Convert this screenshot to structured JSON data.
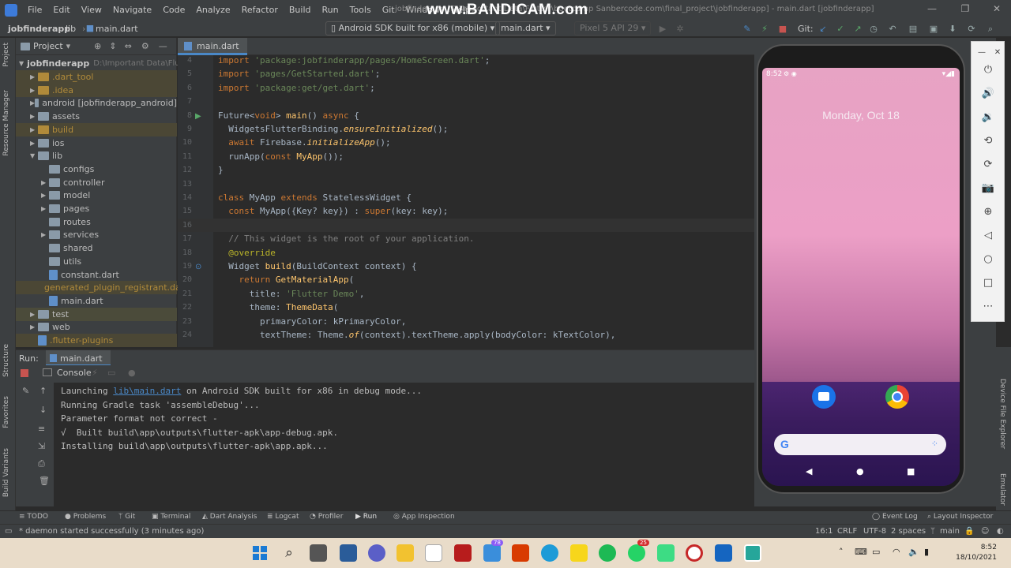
{
  "menubar": {
    "items": [
      "File",
      "Edit",
      "View",
      "Navigate",
      "Code",
      "Analyze",
      "Refactor",
      "Build",
      "Run",
      "Tools",
      "Git",
      "Window",
      "Help"
    ],
    "title": "jobfinderapp [D:\\Important Data\\Flutter\\bootcamp Sanbercode.com\\final_project\\jobfinderapp] - main.dart [jobfinderapp]",
    "watermark": "www.BANDICAM.com"
  },
  "toolbar": {
    "breadcrumb": [
      "jobfinderapp",
      "lib",
      "main.dart"
    ],
    "device_combo": "Android SDK built for x86 (mobile)",
    "config_combo": "main.dart",
    "avd_combo": "Pixel 5 API 29",
    "git_label": "Git:"
  },
  "project_panel": {
    "title": "Project",
    "root": {
      "name": "jobfinderapp",
      "path": "D:\\Important Data\\Flutt"
    },
    "items": [
      {
        "label": ".dart_tool",
        "kind": "folder",
        "excluded": true,
        "indent": 1,
        "expandable": true
      },
      {
        "label": ".idea",
        "kind": "folder",
        "excluded": true,
        "indent": 1,
        "expandable": true
      },
      {
        "label": "android [jobfinderapp_android]",
        "kind": "folder",
        "excluded": false,
        "indent": 1,
        "expandable": true
      },
      {
        "label": "assets",
        "kind": "folder",
        "excluded": false,
        "indent": 1,
        "expandable": true
      },
      {
        "label": "build",
        "kind": "folder",
        "excluded": true,
        "indent": 1,
        "expandable": true
      },
      {
        "label": "ios",
        "kind": "folder",
        "excluded": false,
        "indent": 1,
        "expandable": true
      },
      {
        "label": "lib",
        "kind": "folder",
        "excluded": false,
        "indent": 1,
        "expandable": true,
        "expanded": true
      },
      {
        "label": "configs",
        "kind": "folder",
        "excluded": false,
        "indent": 2,
        "expandable": false
      },
      {
        "label": "controller",
        "kind": "folder",
        "excluded": false,
        "indent": 2,
        "expandable": true
      },
      {
        "label": "model",
        "kind": "folder",
        "excluded": false,
        "indent": 2,
        "expandable": true
      },
      {
        "label": "pages",
        "kind": "folder",
        "excluded": false,
        "indent": 2,
        "expandable": true
      },
      {
        "label": "routes",
        "kind": "folder",
        "excluded": false,
        "indent": 2,
        "expandable": false
      },
      {
        "label": "services",
        "kind": "folder",
        "excluded": false,
        "indent": 2,
        "expandable": true
      },
      {
        "label": "shared",
        "kind": "folder",
        "excluded": false,
        "indent": 2,
        "expandable": false
      },
      {
        "label": "utils",
        "kind": "folder",
        "excluded": false,
        "indent": 2,
        "expandable": false
      },
      {
        "label": "constant.dart",
        "kind": "file",
        "excluded": false,
        "indent": 2,
        "expandable": false
      },
      {
        "label": "generated_plugin_registrant.dart",
        "kind": "file",
        "excluded": true,
        "indent": 2,
        "expandable": false
      },
      {
        "label": "main.dart",
        "kind": "file",
        "excluded": false,
        "indent": 2,
        "expandable": false
      },
      {
        "label": "test",
        "kind": "folder",
        "excluded": false,
        "indent": 1,
        "expandable": true,
        "selected": true
      },
      {
        "label": "web",
        "kind": "folder",
        "excluded": false,
        "indent": 1,
        "expandable": true
      },
      {
        "label": ".flutter-plugins",
        "kind": "file",
        "excluded": true,
        "indent": 1,
        "expandable": false
      }
    ]
  },
  "editor": {
    "tab": "main.dart",
    "lines": [
      {
        "n": "4",
        "html": "<span class='kw'>import</span> <span class='str'>'package:jobfinderapp/pages/HomeScreen.dart'</span>;"
      },
      {
        "n": "5",
        "html": "<span class='kw'>import</span> <span class='str'>'pages/GetStarted.dart'</span>;"
      },
      {
        "n": "6",
        "html": "<span class='kw'>import</span> <span class='str'>'package:get/get.dart'</span>;"
      },
      {
        "n": "7",
        "html": ""
      },
      {
        "n": "8",
        "html": "Future&lt;<span class='kw'>void</span>&gt; <span class='fn'>main</span>() <span class='kw'>async</span> {"
      },
      {
        "n": "9",
        "html": "  WidgetsFlutterBinding.<span class='fn it'>ensureInitialized</span>();"
      },
      {
        "n": "10",
        "html": "  <span class='kw'>await</span> Firebase.<span class='fn it'>initializeApp</span>();"
      },
      {
        "n": "11",
        "html": "  runApp(<span class='kw'>const</span> <span class='fn'>MyApp</span>());"
      },
      {
        "n": "12",
        "html": "}"
      },
      {
        "n": "13",
        "html": ""
      },
      {
        "n": "14",
        "html": "<span class='kw'>class</span> MyApp <span class='kw'>extends</span> StatelessWidget {"
      },
      {
        "n": "15",
        "html": "  <span class='kw'>const</span> MyApp({Key? key}) : <span class='kw'>super</span>(key: key);"
      },
      {
        "n": "16",
        "html": ""
      },
      {
        "n": "17",
        "html": "  <span class='cm'>// This widget is the root of your application.</span>"
      },
      {
        "n": "18",
        "html": "  <span class='ann'>@override</span>"
      },
      {
        "n": "19",
        "html": "  Widget <span class='fn'>build</span>(BuildContext context) {"
      },
      {
        "n": "20",
        "html": "    <span class='kw'>return</span> <span class='fn'>GetMaterialApp</span>("
      },
      {
        "n": "21",
        "html": "      title: <span class='str'>'Flutter Demo'</span>,"
      },
      {
        "n": "22",
        "html": "      theme: <span class='fn'>ThemeData</span>("
      },
      {
        "n": "23",
        "html": "        primaryColor: kPrimaryColor,"
      },
      {
        "n": "24",
        "html": "        textTheme: Theme.<span class='fn it'>of</span>(context).textTheme.apply(bodyColor: kTextColor),"
      }
    ]
  },
  "run_panel": {
    "label": "Run:",
    "tab": "main.dart",
    "console_tab": "Console",
    "lines": [
      {
        "pre": "Launching ",
        "link": "lib\\main.dart",
        "post": " on Android SDK built for x86 in debug mode..."
      },
      {
        "pre": "Running Gradle task 'assembleDebug'...",
        "link": "",
        "post": ""
      },
      {
        "pre": "Parameter format not correct -",
        "link": "",
        "post": ""
      },
      {
        "pre": "√  Built build\\app\\outputs\\flutter-apk\\app-debug.apk.",
        "link": "",
        "post": ""
      },
      {
        "pre": "Installing build\\app\\outputs\\flutter-apk\\app.apk...",
        "link": "",
        "post": ""
      }
    ]
  },
  "left_tabs": [
    "Project",
    "Resource Manager",
    "Structure",
    "Favorites",
    "Build Variants"
  ],
  "right_tabs": [
    "Device File Explorer",
    "Emulator"
  ],
  "phone": {
    "time": "8:52",
    "date": "Monday, Oct 18",
    "search_hint": "G"
  },
  "bottom_tabs": [
    "TODO",
    "Problems",
    "Git",
    "Terminal",
    "Dart Analysis",
    "Logcat",
    "Profiler",
    "Run",
    "App Inspection"
  ],
  "bottom_right_tabs": [
    "Event Log",
    "Layout Inspector"
  ],
  "status": {
    "message": "* daemon started successfully (3 minutes ago)",
    "position": "16:1",
    "line_sep": "CRLF",
    "encoding": "UTF-8",
    "indent": "2 spaces",
    "branch": "main"
  },
  "taskbar": {
    "time": "8:52",
    "date": "18/10/2021",
    "badges": [
      "78",
      "25"
    ]
  },
  "colors": {
    "accent": "#4a88c7",
    "keyword": "#cc7832",
    "string": "#6a8759",
    "function": "#ffc66d"
  }
}
